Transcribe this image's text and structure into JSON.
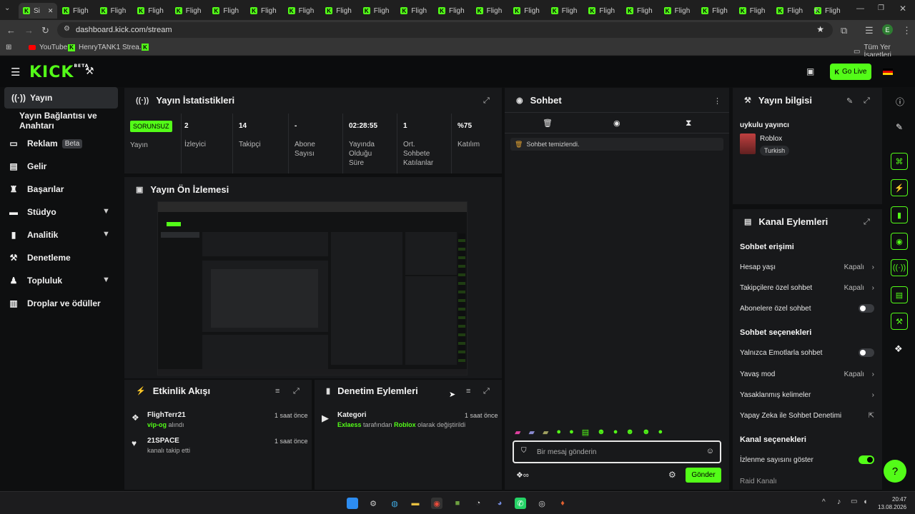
{
  "browser": {
    "tabs": [
      "Si",
      "Fligh",
      "Fligh",
      "Fligh",
      "Fligh",
      "Fligh",
      "Fligh",
      "Fligh",
      "Fligh",
      "Fligh",
      "Fligh",
      "Fligh",
      "Fligh",
      "Fligh",
      "Fligh",
      "Fligh",
      "Fligh",
      "Fligh",
      "Fligh",
      "Fligh",
      "Fligh",
      "Fligh"
    ],
    "url": "dashboard.kick.com/stream",
    "bookmarks": [
      "YouTube",
      "HenryTANK1 Strea..."
    ],
    "all_bookmarks": "Tüm Yer İşaretleri",
    "profile_initial": "E"
  },
  "header": {
    "logo": "KICK",
    "logo_sup": "BETA",
    "go_live": "Go Live"
  },
  "sidebar": {
    "items": [
      {
        "label": "Yayın",
        "icon": "broadcast-icon"
      },
      {
        "label": "Yayın Bağlantısı ve Anahtarı"
      },
      {
        "label": "Reklam",
        "badge": "Beta",
        "icon": "ad-icon"
      },
      {
        "label": "Gelir",
        "icon": "money-icon"
      },
      {
        "label": "Başarılar",
        "icon": "trophy-icon"
      },
      {
        "label": "Stüdyo",
        "icon": "studio-icon"
      },
      {
        "label": "Analitik",
        "icon": "chart-icon"
      },
      {
        "label": "Denetleme",
        "icon": "wrench-icon"
      },
      {
        "label": "Topluluk",
        "icon": "community-icon"
      },
      {
        "label": "Droplar ve ödüller",
        "icon": "gift-icon"
      }
    ]
  },
  "stats": {
    "title": "Yayın İstatistikleri",
    "status": "SORUNSUZ",
    "items": [
      {
        "value": "",
        "label": "Yayın"
      },
      {
        "value": "2",
        "label": "İzleyici"
      },
      {
        "value": "14",
        "label": "Takipçi"
      },
      {
        "value": "-",
        "label": "Abone Sayısı"
      },
      {
        "value": "02:28:55",
        "label": "Yayında Olduğu Süre"
      },
      {
        "value": "1",
        "label": "Ort. Sohbete Katılanlar"
      },
      {
        "value": "%75",
        "label": "Katılım"
      }
    ]
  },
  "preview": {
    "title": "Yayın Ön İzlemesi"
  },
  "activity": {
    "title": "Etkinlik Akışı",
    "events": [
      {
        "name": "FlighTerr21",
        "highlight": "vip-og",
        "text": " alındı",
        "time": "1 saat önce"
      },
      {
        "name": "21SPACE",
        "highlight": "",
        "text": "kanalı takip etti",
        "time": "1 saat önce"
      }
    ]
  },
  "moderation": {
    "title": "Denetim Eylemleri",
    "events": [
      {
        "name": "Kategori",
        "user": "Exlaess",
        "mid": " tarafından ",
        "cat": "Roblox",
        "tail": " olarak değiştirildi",
        "time": "1 saat önce"
      }
    ]
  },
  "chat": {
    "title": "Sohbet",
    "cleared": "Sohbet temizlendi.",
    "placeholder": "Bir mesaj gönderin",
    "send": "Gönder"
  },
  "stream_info": {
    "title": "Yayın bilgisi",
    "stream_title": "uykulu yayıncı",
    "category": "Roblox",
    "language": "Turkish"
  },
  "channel_actions": {
    "title": "Kanal Eylemleri",
    "chat_access_head": "Sohbet erişimi",
    "rows_access": [
      {
        "label": "Hesap yaşı",
        "value": "Kapalı",
        "kind": "chevron"
      },
      {
        "label": "Takipçilere özel sohbet",
        "value": "Kapalı",
        "kind": "chevron"
      },
      {
        "label": "Abonelere özel sohbet",
        "value": "",
        "kind": "toggle-off"
      }
    ],
    "chat_options_head": "Sohbet seçenekleri",
    "rows_options": [
      {
        "label": "Yalnızca Emotlarla sohbet",
        "value": "",
        "kind": "toggle-off"
      },
      {
        "label": "Yavaş mod",
        "value": "Kapalı",
        "kind": "chevron"
      },
      {
        "label": "Yasaklanmış kelimeler",
        "value": "",
        "kind": "chevron"
      },
      {
        "label": "Yapay Zeka ile Sohbet Denetimi",
        "value": "",
        "kind": "external"
      }
    ],
    "channel_options_head": "Kanal seçenekleri",
    "rows_channel": [
      {
        "label": "İzlenme sayısını göster",
        "value": "",
        "kind": "toggle-on"
      },
      {
        "label": "Raid Kanalı",
        "value": "",
        "kind": "none"
      }
    ]
  },
  "taskbar": {
    "time": "20:47",
    "date": "13.08.2026"
  },
  "colors": {
    "accent": "#53fc18",
    "panel": "#18191b",
    "bg": "#0e0f10"
  }
}
